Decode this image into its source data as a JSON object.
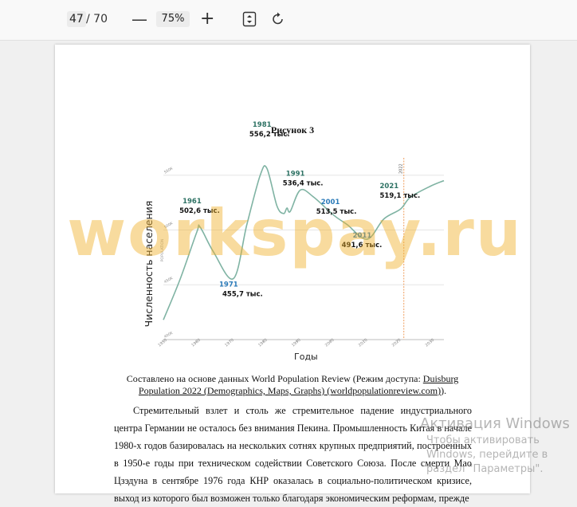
{
  "toolbar": {
    "page_current": "47",
    "page_total": "/ 70",
    "zoom_out": "—",
    "zoom_level": "75%",
    "zoom_in": "+"
  },
  "page": {
    "figure_title": "Рисунок 3",
    "source_prefix": "Составлено на основе данных World Population Review (Режим доступа: ",
    "source_link": "Duisburg Population 2022 (Demographics, Maps, Graphs) (worldpopulationreview.com)",
    "source_suffix": ").",
    "body_paragraph": "Стремительный взлет и столь же стремительное падение индустриального центра Германии не осталось без внимания Пекина. Промышленность Китая в начале 1980-х годов базировалась на нескольких сотнях крупных предприятий, построенных в 1950-е годы при техническом содействии Советского Союза. После смерти Мао Цзэдуна в сентябре 1976 года КНР оказалась в социально-политическом кризисе, выход из которого был возможен только благодаря экономическим реформам, прежде"
  },
  "chart_data": {
    "type": "line",
    "title": "Рисунок 3",
    "xlabel": "Годы",
    "ylabel": "Численность населения",
    "inner_ylabel": "POPULATION",
    "x_ticks": [
      "1950",
      "1960",
      "1970",
      "1980",
      "1990",
      "2000",
      "2010",
      "2020",
      "2030"
    ],
    "y_ticks": [
      "400K",
      "450K",
      "500K",
      "550K"
    ],
    "vline_label": "2022",
    "xlim": [
      1950,
      2034
    ],
    "ylim": [
      400,
      560
    ],
    "series": [
      {
        "color": "#7fb3a3",
        "x": [
          1950,
          1955,
          1960,
          1961,
          1965,
          1971,
          1975,
          1979,
          1981,
          1984,
          1986,
          1987,
          1988,
          1991,
          1995,
          2001,
          2005,
          2011,
          2016,
          2021,
          2024,
          2030,
          2034
        ],
        "y": [
          418,
          455,
          498,
          502.6,
          480,
          455.7,
          505,
          550,
          556.2,
          522,
          515,
          520,
          517,
          536.4,
          530,
          513.5,
          505,
          491.6,
          510,
          519.1,
          530,
          540,
          545
        ]
      }
    ],
    "annotations": [
      {
        "year": "1961",
        "value": "502,6 тыс.",
        "year_color": "#2e7264"
      },
      {
        "year": "1971",
        "value": "455,7 тыс.",
        "year_color": "#2b7bb9"
      },
      {
        "year": "1981",
        "value": "556,2 тыс.",
        "year_color": "#2e7264"
      },
      {
        "year": "1991",
        "value": "536,4 тыс.",
        "year_color": "#2e7264"
      },
      {
        "year": "2001",
        "value": "513,5 тыс.",
        "year_color": "#2b7bb9"
      },
      {
        "year": "2011",
        "value": "491,6 тыс.",
        "year_color": "#2b7bb9"
      },
      {
        "year": "2021",
        "value": "519,1 тыс.",
        "year_color": "#2e7264"
      }
    ]
  },
  "watermark": {
    "text": "workspay.ru",
    "activation_title": "Активация Windows",
    "activation_hint": "Чтобы активировать Windows, перейдите в раздел \"Параметры\"."
  },
  "colors": {
    "line": "#7fb3a3",
    "vline": "#f0a060",
    "watermark": "#f0af28"
  }
}
